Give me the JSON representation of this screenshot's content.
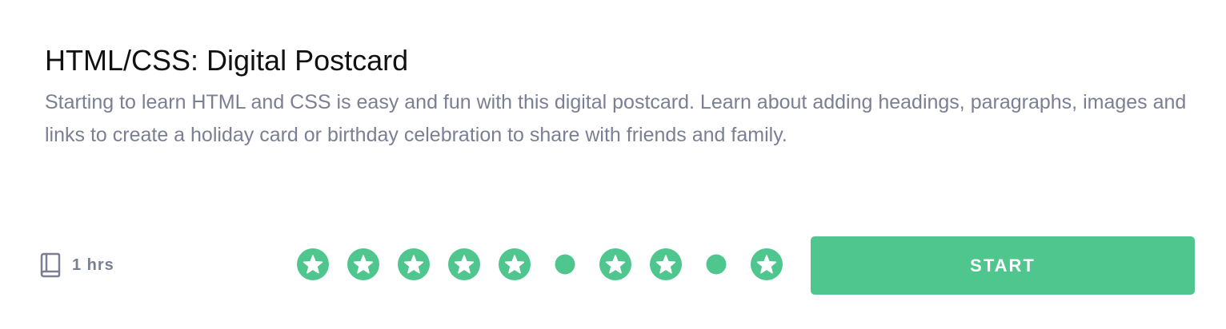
{
  "project": {
    "title": "HTML/CSS: Digital Postcard",
    "description": "Starting to learn HTML and CSS is easy and fun with this digital postcard. Learn about adding headings, paragraphs, images and links to create a holiday card or birthday celebration to share with friends and family."
  },
  "meta": {
    "duration_icon": "book-icon",
    "duration_label": "1 hrs"
  },
  "steps": [
    {
      "kind": "star",
      "icon": "star-icon"
    },
    {
      "kind": "star",
      "icon": "star-icon"
    },
    {
      "kind": "star",
      "icon": "star-icon"
    },
    {
      "kind": "star",
      "icon": "star-icon"
    },
    {
      "kind": "star",
      "icon": "star-icon"
    },
    {
      "kind": "dot",
      "icon": "dot-icon"
    },
    {
      "kind": "star",
      "icon": "star-icon"
    },
    {
      "kind": "star",
      "icon": "star-icon"
    },
    {
      "kind": "dot",
      "icon": "dot-icon"
    },
    {
      "kind": "star",
      "icon": "star-icon"
    }
  ],
  "actions": {
    "start_label": "START"
  },
  "colors": {
    "accent": "#4fc68e",
    "title": "#111111",
    "muted": "#7a7f93",
    "background": "#ffffff"
  }
}
